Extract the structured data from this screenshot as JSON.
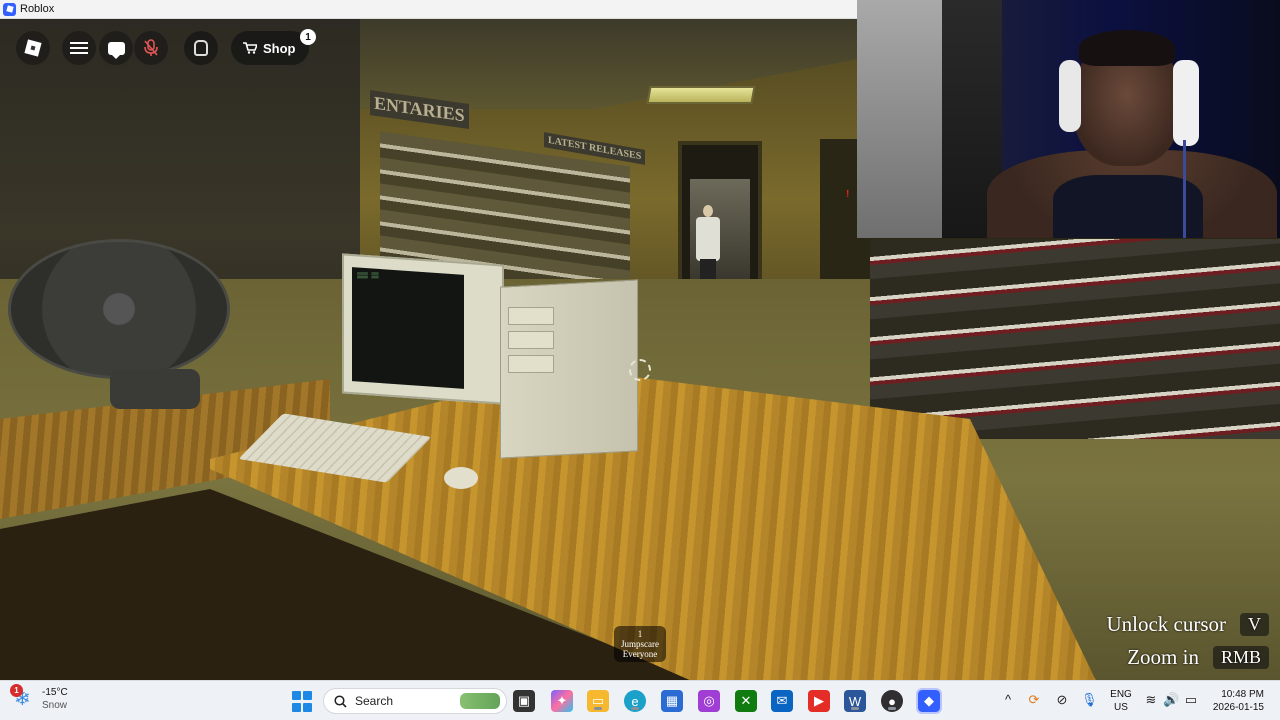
{
  "window": {
    "title": "Roblox",
    "icon": "roblox-icon"
  },
  "hud": {
    "logo_icon": "roblox-logo-icon",
    "menu_icon": "hamburger-menu-icon",
    "chat_icon": "chat-bubble-icon",
    "mic_icon": "microphone-muted-icon",
    "backpack_icon": "backpack-icon",
    "shop_label": "Shop",
    "shop_badge": "1"
  },
  "scene": {
    "sign_1": "ENTARIES",
    "sign_2": "LATEST RELEASES",
    "monitor_text": "▒▒▒ ▒▒"
  },
  "game_overlay": {
    "jumpscare_count": "1",
    "jumpscare_line1": "Jumpscare",
    "jumpscare_line2": "Everyone",
    "unlock_label": "Unlock cursor",
    "unlock_key": "V",
    "zoom_label": "Zoom in",
    "zoom_key": "RMB"
  },
  "taskbar": {
    "weather_badge": "1",
    "temperature": "-15°C",
    "condition": "Snow",
    "search_placeholder": "Search",
    "apps": [
      {
        "name": "task-view-icon",
        "color": "#333333"
      },
      {
        "name": "copilot-icon",
        "color": "#7b61ff"
      },
      {
        "name": "file-explorer-icon",
        "color": "#f5b82e"
      },
      {
        "name": "edge-icon",
        "color": "#1aa1c9"
      },
      {
        "name": "microsoft-store-icon",
        "color": "#2b6cd4"
      },
      {
        "name": "app-purple-icon",
        "color": "#a03dd4"
      },
      {
        "name": "xbox-icon",
        "color": "#107c10"
      },
      {
        "name": "outlook-icon",
        "color": "#0a64c2"
      },
      {
        "name": "youtube-icon",
        "color": "#e52d27"
      },
      {
        "name": "word-icon",
        "color": "#2b579a"
      },
      {
        "name": "obs-icon",
        "color": "#302e31"
      },
      {
        "name": "roblox-taskbar-icon",
        "color": "#335fff"
      }
    ],
    "lang_top": "ENG",
    "lang_bottom": "US",
    "time": "10:48 PM",
    "date": "2026-01-15"
  }
}
